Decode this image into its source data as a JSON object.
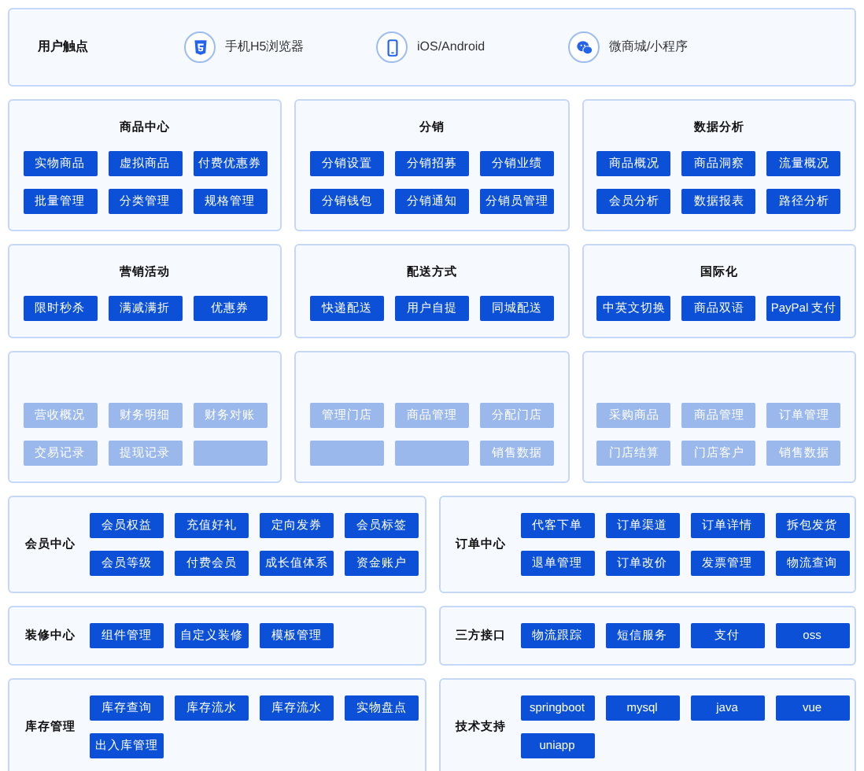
{
  "touchpoints": {
    "title": "用户触点",
    "items": [
      {
        "label": "手机H5浏览器"
      },
      {
        "label": "iOS/Android"
      },
      {
        "label": "微商城/小程序"
      }
    ]
  },
  "top_rows": [
    {
      "faded": false,
      "panels": [
        {
          "title": "商品中心",
          "buttons": [
            {
              "label": "实物商品"
            },
            {
              "label": "虚拟商品"
            },
            {
              "label": "付费优惠券"
            },
            {
              "label": "批量管理"
            },
            {
              "label": "分类管理"
            },
            {
              "label": "规格管理"
            }
          ]
        },
        {
          "title": "分销",
          "buttons": [
            {
              "label": "分销设置"
            },
            {
              "label": "分销招募"
            },
            {
              "label": "分销业绩"
            },
            {
              "label": "分销钱包"
            },
            {
              "label": "分销通知"
            },
            {
              "label": "分销员管理"
            }
          ]
        },
        {
          "title": "数据分析",
          "buttons": [
            {
              "label": "商品概况"
            },
            {
              "label": "商品洞察"
            },
            {
              "label": "流量概况"
            },
            {
              "label": "会员分析"
            },
            {
              "label": "数据报表"
            },
            {
              "label": "路径分析"
            }
          ]
        }
      ]
    },
    {
      "faded": false,
      "panels": [
        {
          "title": "营销活动",
          "buttons": [
            {
              "label": "限时秒杀"
            },
            {
              "label": "满减满折"
            },
            {
              "label": "优惠券"
            }
          ]
        },
        {
          "title": "配送方式",
          "buttons": [
            {
              "label": "快递配送"
            },
            {
              "label": "用户自提"
            },
            {
              "label": "同城配送"
            }
          ]
        },
        {
          "title": "国际化",
          "buttons": [
            {
              "label": "中英文切换"
            },
            {
              "label": "商品双语"
            },
            {
              "label": "PayPal 支付"
            }
          ]
        }
      ]
    },
    {
      "faded": true,
      "panels": [
        {
          "buttons": [
            {
              "label": "营收概况"
            },
            {
              "label": "财务明细"
            },
            {
              "label": "财务对账"
            },
            {
              "label": "交易记录"
            },
            {
              "label": "提现记录"
            },
            {
              "kind": "blank"
            }
          ]
        },
        {
          "buttons": [
            {
              "label": "管理门店"
            },
            {
              "label": "商品管理"
            },
            {
              "label": "分配门店"
            },
            {
              "kind": "blank"
            },
            {
              "kind": "blank"
            },
            {
              "label": "销售数据"
            }
          ]
        },
        {
          "buttons": [
            {
              "label": "采购商品"
            },
            {
              "label": "商品管理"
            },
            {
              "label": "订单管理"
            },
            {
              "label": "门店结算"
            },
            {
              "label": "门店客户"
            },
            {
              "label": "销售数据"
            }
          ]
        }
      ]
    }
  ],
  "side_rows": [
    [
      {
        "title": "会员中心",
        "buttons": [
          {
            "label": "会员权益"
          },
          {
            "label": "充值好礼"
          },
          {
            "label": "定向发券"
          },
          {
            "label": "会员标签"
          },
          {
            "label": "会员等级"
          },
          {
            "label": "付费会员"
          },
          {
            "label": "成长值体系"
          },
          {
            "label": "资金账户"
          }
        ]
      },
      {
        "title": "订单中心",
        "buttons": [
          {
            "label": "代客下单"
          },
          {
            "label": "订单渠道"
          },
          {
            "label": "订单详情"
          },
          {
            "label": "拆包发货"
          },
          {
            "label": "退单管理"
          },
          {
            "label": "订单改价"
          },
          {
            "label": "发票管理"
          },
          {
            "label": "物流查询"
          }
        ]
      }
    ],
    [
      {
        "title": "装修中心",
        "buttons": [
          {
            "label": "组件管理"
          },
          {
            "label": "自定义装修"
          },
          {
            "label": "模板管理"
          }
        ]
      },
      {
        "title": "三方接口",
        "buttons": [
          {
            "label": "物流跟踪"
          },
          {
            "label": "短信服务"
          },
          {
            "label": "支付"
          },
          {
            "label": "oss"
          }
        ]
      }
    ],
    [
      {
        "title": "库存管理",
        "buttons": [
          {
            "label": "库存查询"
          },
          {
            "label": "库存流水"
          },
          {
            "label": "库存流水"
          },
          {
            "label": "实物盘点"
          },
          {
            "label": "出入库管理"
          }
        ]
      },
      {
        "title": "技术支持",
        "buttons": [
          {
            "label": "springboot"
          },
          {
            "label": "mysql"
          },
          {
            "label": "java"
          },
          {
            "label": "vue"
          },
          {
            "label": "uniapp"
          }
        ]
      }
    ]
  ]
}
